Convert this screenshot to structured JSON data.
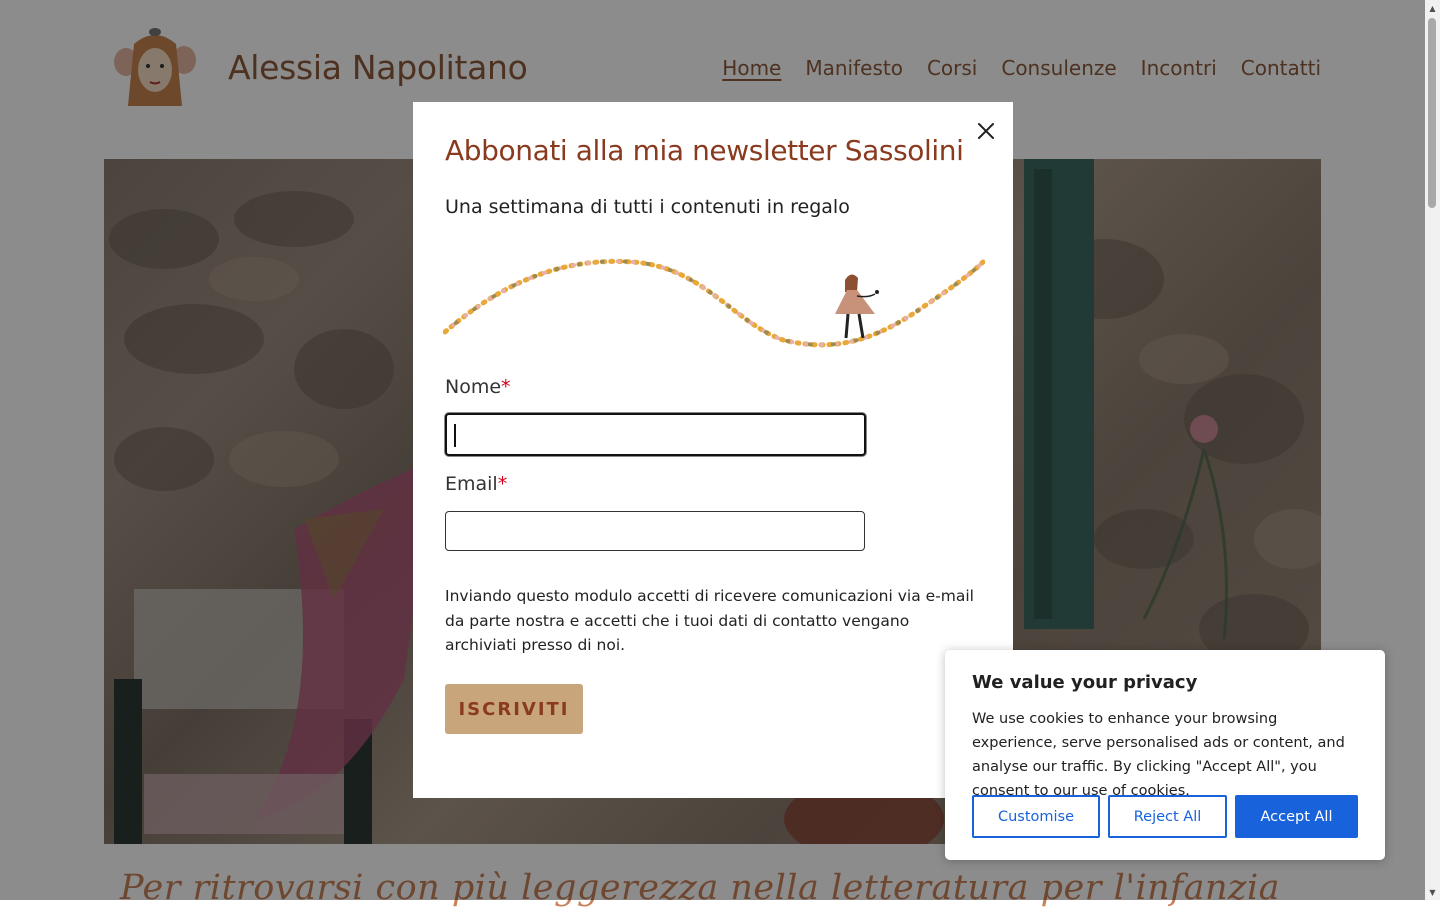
{
  "site": {
    "title": "Alessia Napolitano",
    "nav": [
      {
        "label": "Home",
        "active": true
      },
      {
        "label": "Manifesto"
      },
      {
        "label": "Corsi"
      },
      {
        "label": "Consulenze"
      },
      {
        "label": "Incontri"
      },
      {
        "label": "Contatti"
      }
    ],
    "tagline": "Per ritrovarsi con più leggerezza nella letteratura per l'infanzia"
  },
  "newsletter_modal": {
    "title": "Abbonati alla mia newsletter Sassolini",
    "subtitle": "Una settimana di tutti i contenuti in regalo",
    "fields": [
      {
        "label": "Nome",
        "required_mark": "*",
        "value": ""
      },
      {
        "label": "Email",
        "required_mark": "*",
        "value": ""
      }
    ],
    "consent_text": "Inviando questo modulo accetti di ricevere comunicazioni via e-mail da parte nostra e accetti che i tuoi dati di contatto vengano archiviati presso di noi.",
    "submit_label": "ISCRIVITI"
  },
  "cookie_banner": {
    "title": "We value your privacy",
    "text": "We use cookies to enhance your browsing experience, serve personalised ads or content, and analyse our traffic. By clicking \"Accept All\", you consent to our use of cookies.",
    "buttons": {
      "customise": "Customise",
      "reject": "Reject All",
      "accept": "Accept All"
    }
  },
  "colors": {
    "brand": "#8c5a3c",
    "title_accent": "#8a3a1e",
    "button_bg": "#c8a57a",
    "required": "#d0021b",
    "cookie_primary": "#1863dc"
  }
}
